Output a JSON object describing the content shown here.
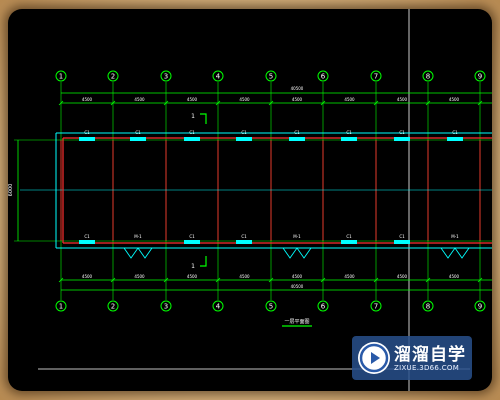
{
  "drawing": {
    "axis_labels": [
      "1",
      "2",
      "3",
      "4",
      "5",
      "6",
      "7",
      "8",
      "9"
    ],
    "bay_dims_top": [
      "4500",
      "4500",
      "4500",
      "4500",
      "4500",
      "4500",
      "4500",
      "4500"
    ],
    "bay_dims_bottom": [
      "4500",
      "4500",
      "4500",
      "4500",
      "4500",
      "4500",
      "4500",
      "4500"
    ],
    "total_dim": "40500",
    "side_dim": "6000",
    "window_label": "C1",
    "door_label": "M-1",
    "title": "一层平面图"
  },
  "colors": {
    "axis_bubble": "#00ff00",
    "dim_line": "#00ff00",
    "wall_outer": "#00ffff",
    "wall_inner": "#ff3030",
    "column_line": "#ff3030",
    "window": "#00ffff",
    "door": "#00ffff",
    "text": "#ffffff"
  },
  "watermark": {
    "title": "溜溜自学",
    "url": "ZIXUE.3D66.COM",
    "icon": "play-icon"
  }
}
